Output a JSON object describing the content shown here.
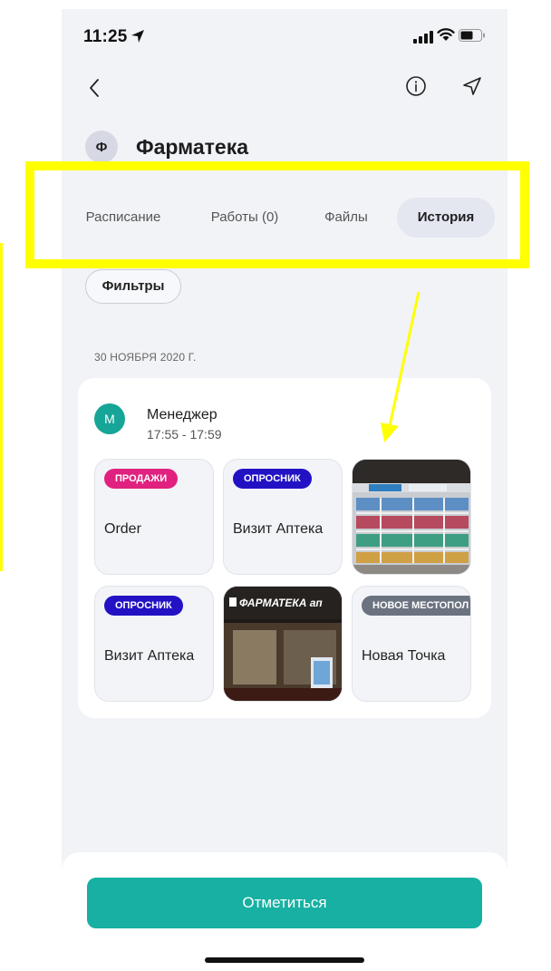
{
  "status_bar": {
    "time": "11:25"
  },
  "header": {
    "avatar_letter": "Ф",
    "title": "Фарматека"
  },
  "tabs": [
    {
      "label": "Расписание",
      "active": false
    },
    {
      "label": "Работы (0)",
      "active": false
    },
    {
      "label": "Файлы",
      "active": false
    },
    {
      "label": "История",
      "active": true
    }
  ],
  "filters": {
    "label": "Фильтры"
  },
  "history": {
    "date": "30 НОЯБРЯ 2020 Г.",
    "entry": {
      "avatar_letter": "M",
      "name": "Менеджер",
      "time_range": "17:55 - 17:59",
      "tiles": [
        {
          "type": "activity",
          "tag": "ПРОДАЖИ",
          "tag_color": "#e0217f",
          "label": "Order"
        },
        {
          "type": "activity",
          "tag": "ОПРОСНИК",
          "tag_color": "#2212c4",
          "label": "Визит Аптека"
        },
        {
          "type": "photo",
          "photo": "pharmacy-shelves"
        },
        {
          "type": "activity",
          "tag": "ОПРОСНИК",
          "tag_color": "#2212c4",
          "label": "Визит Аптека"
        },
        {
          "type": "photo",
          "photo": "pharmacy-storefront",
          "sign_text": "ФАРМАТЕКА ап"
        },
        {
          "type": "activity",
          "tag": "НОВОЕ МЕСТОПОЛ",
          "tag_color": "#6b7280",
          "label": "Новая Точка"
        }
      ]
    }
  },
  "footer": {
    "checkin_label": "Отметиться"
  },
  "colors": {
    "accent": "#17b0a2",
    "highlight": "#ffff00",
    "background": "#f2f3f7"
  }
}
